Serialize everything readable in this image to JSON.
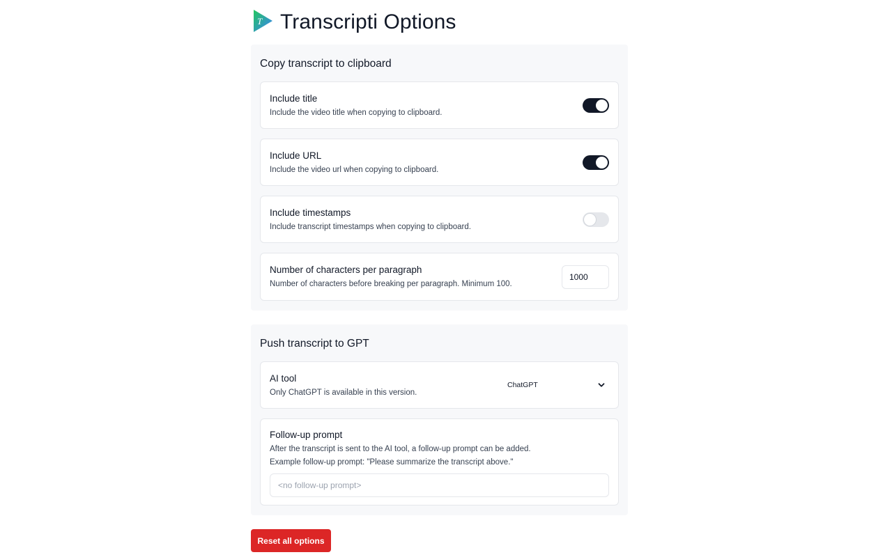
{
  "header": {
    "title": "Transcripti Options",
    "logo_letter": "T",
    "logo_icon": "play-triangle-logo"
  },
  "clipboard": {
    "title": "Copy transcript to clipboard",
    "include_title": {
      "label": "Include title",
      "description": "Include the video title when copying to clipboard.",
      "enabled": true
    },
    "include_url": {
      "label": "Include URL",
      "description": "Include the video url when copying to clipboard.",
      "enabled": true
    },
    "include_timestamps": {
      "label": "Include timestamps",
      "description": "Include transcript timestamps when copying to clipboard.",
      "enabled": false
    },
    "chars_per_paragraph": {
      "label": "Number of characters per paragraph",
      "description": "Number of characters before breaking per paragraph. Minimum 100.",
      "value": "1000"
    }
  },
  "gpt": {
    "title": "Push transcript to GPT",
    "ai_tool": {
      "label": "AI tool",
      "description": "Only ChatGPT is available in this version.",
      "selected": "ChatGPT",
      "icon": "chevron-down-icon"
    },
    "followup": {
      "label": "Follow-up prompt",
      "description_line1": "After the transcript is sent to the AI tool, a follow-up prompt can be added.",
      "description_line2": "Example follow-up prompt: \"Please summarize the transcript above.\"",
      "value": "",
      "placeholder": "<no follow-up prompt>"
    }
  },
  "reset_button": {
    "label": "Reset all options"
  },
  "colors": {
    "toggle_on": "#111827",
    "toggle_off": "#e5e7eb",
    "reset_bg": "#dc2626",
    "section_bg": "#f7f8fa",
    "logo_green": "#22c55e",
    "logo_blue": "#3b82f6"
  }
}
